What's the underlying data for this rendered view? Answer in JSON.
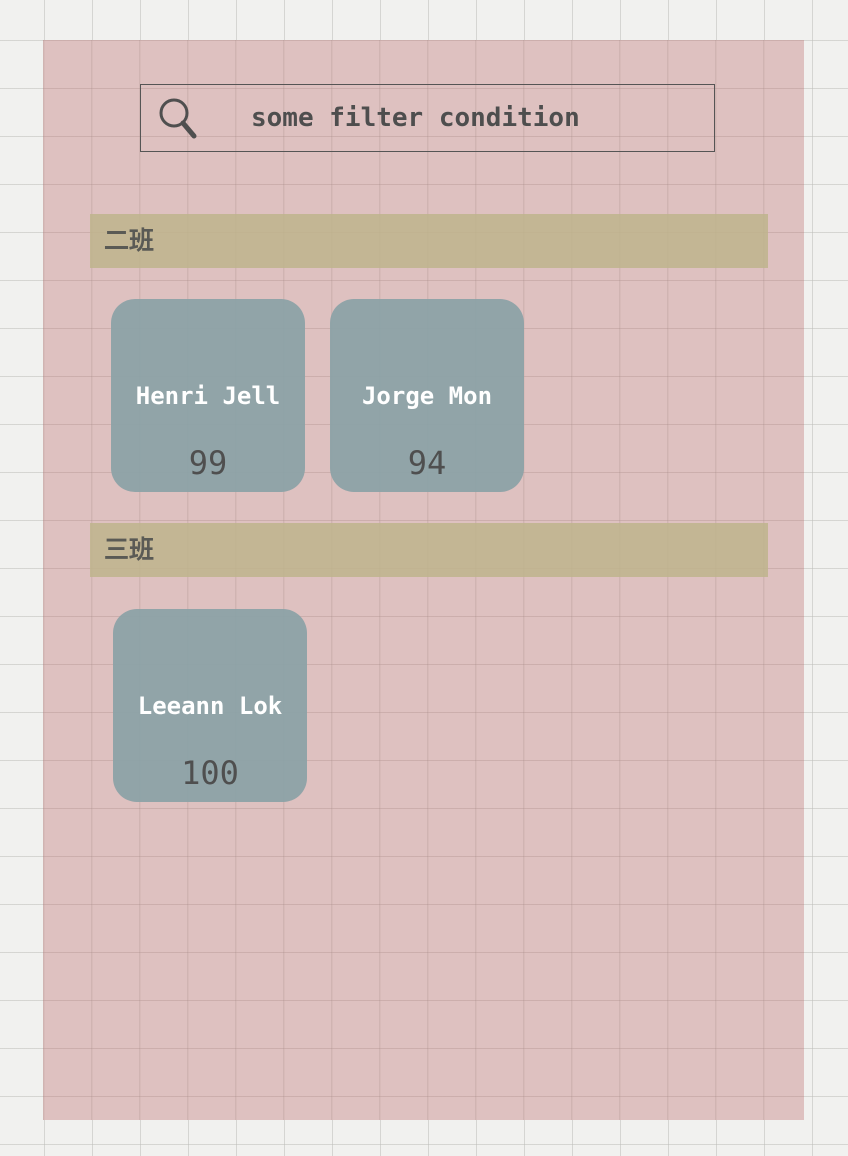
{
  "search": {
    "placeholder": "some filter condition",
    "icon": "search-icon"
  },
  "groups": [
    {
      "label": "二班",
      "students": [
        {
          "name": "Henri Jell",
          "score": "99"
        },
        {
          "name": "Jorge Mon",
          "score": "94"
        }
      ]
    },
    {
      "label": "三班",
      "students": [
        {
          "name": "Leeann Lok",
          "score": "100"
        }
      ]
    }
  ],
  "colors": {
    "panel": "#d8b4b2",
    "group_header": "#beb48c",
    "card": "#8ca2a7",
    "card_name": "#ffffff",
    "card_score": "#4f4f4f"
  }
}
